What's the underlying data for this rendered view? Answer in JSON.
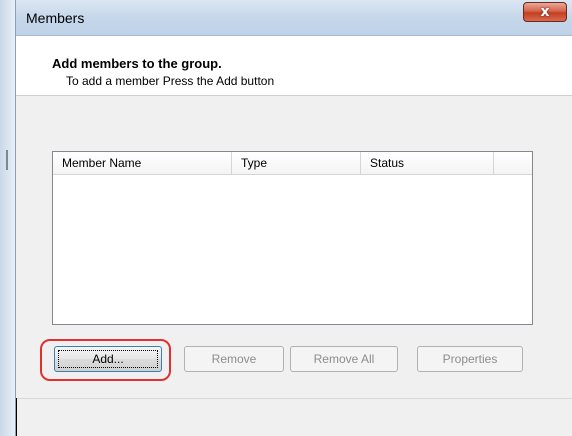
{
  "window": {
    "title": "Members",
    "close_glyph": "x"
  },
  "header": {
    "title": "Add members to the group.",
    "subtitle": "To add a member Press the Add button"
  },
  "list": {
    "columns": [
      "Member Name",
      "Type",
      "Status"
    ],
    "rows": []
  },
  "buttons": {
    "add": "Add...",
    "remove": "Remove",
    "remove_all": "Remove All",
    "properties": "Properties"
  },
  "colors": {
    "highlight": "#e03030",
    "close_button": "#c43f22"
  },
  "icons": {
    "close": "close-icon"
  }
}
